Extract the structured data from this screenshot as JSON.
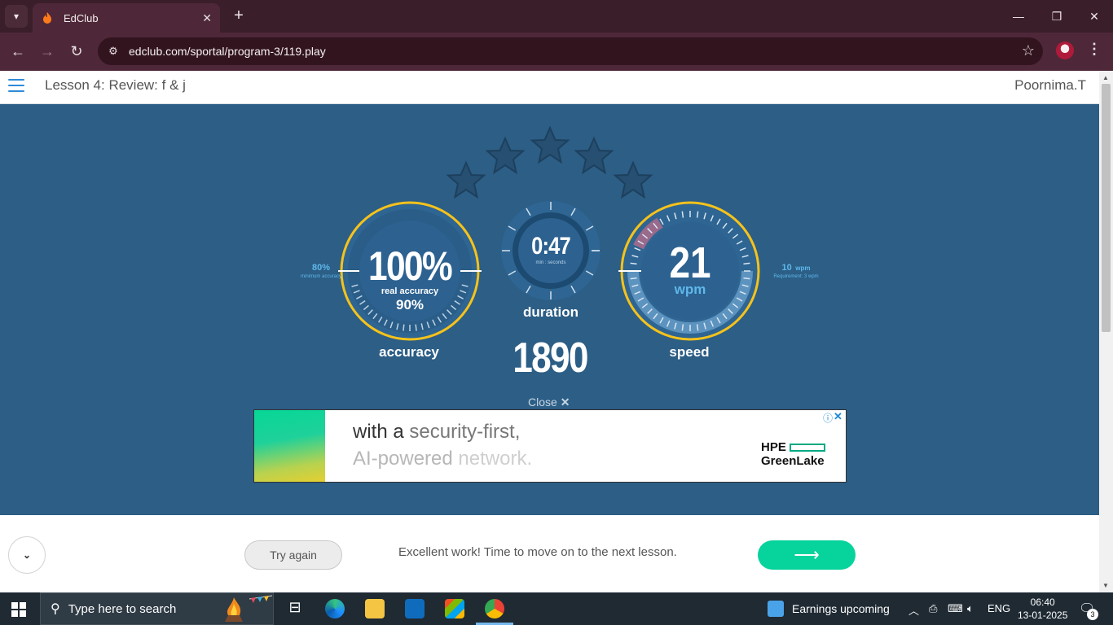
{
  "browser": {
    "tab_title": "EdClub",
    "url": "edclub.com/sportal/program-3/119.play",
    "tab_menu_icon": "chevron-down-icon",
    "new_tab_icon": "plus-icon"
  },
  "header": {
    "lesson_title": "Lesson 4: Review: f & j",
    "username": "Poornima.T"
  },
  "results": {
    "stars_total": 5,
    "stars_earned": 0,
    "accuracy": {
      "value": "100%",
      "real_label": "real accuracy",
      "real_value": "90%",
      "label": "accuracy",
      "min_value": "80%",
      "min_label": "minimum accuracy"
    },
    "duration": {
      "value": "0:47",
      "unit": "min : seconds",
      "label": "duration"
    },
    "speed": {
      "value": "21",
      "unit": "wpm",
      "label": "speed",
      "req_value": "10",
      "req_unit": "wpm",
      "req_label": "Requirement: 3 wpm"
    },
    "score": "1890",
    "close_label": "Close",
    "close_symbol": "✕"
  },
  "ad": {
    "line1_a": "with a ",
    "line1_b": "security-first,",
    "line2_a": "AI-powered ",
    "line2_b": "network.",
    "brand_top": "HPE",
    "brand_bottom": "GreenLake",
    "info_symbol": "ⓘ",
    "close_symbol": "✕"
  },
  "footer": {
    "try_again": "Try again",
    "message": "Excellent work! Time to move on to the next lesson.",
    "next_arrow": "⟶"
  },
  "taskbar": {
    "search_placeholder": "Type here to search",
    "earnings": "Earnings upcoming",
    "language": "ENG",
    "time": "06:40",
    "date": "13-01-2025",
    "notification_count": "3"
  },
  "colors": {
    "page_bg": "#2c5e86",
    "gauge_ring": "#f6c21b",
    "next_button": "#07d39c",
    "accent_blue": "#5fb8ea"
  }
}
